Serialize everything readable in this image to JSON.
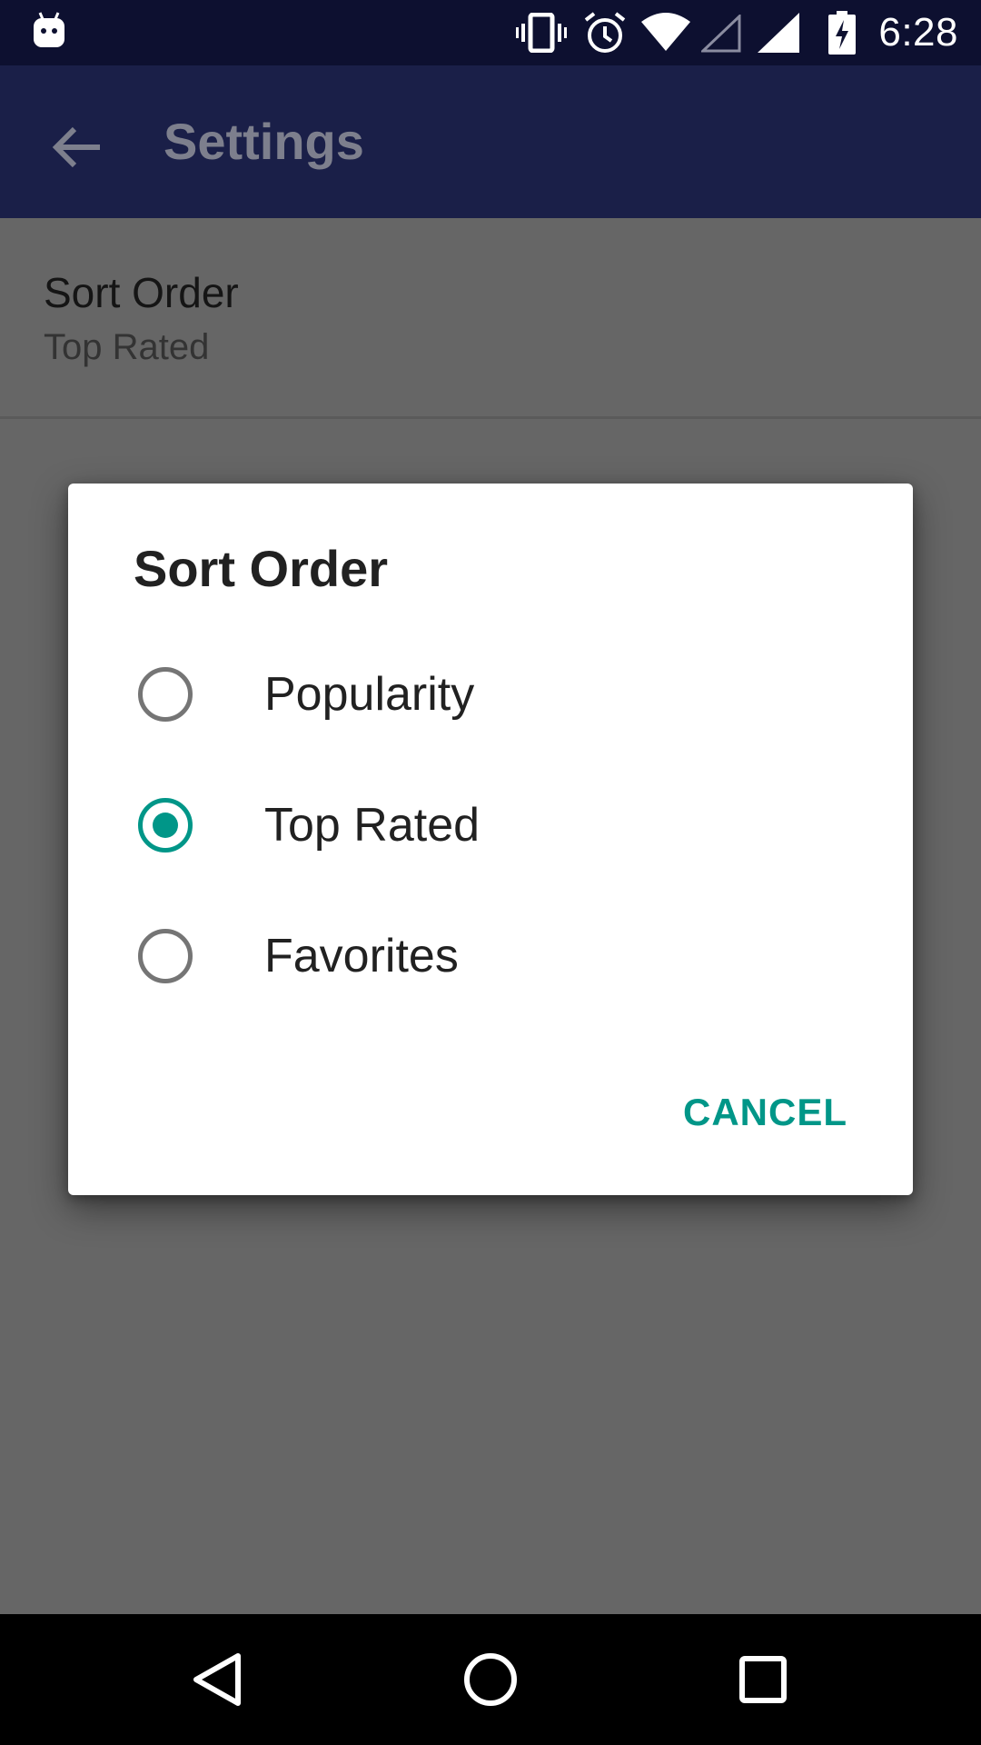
{
  "status_bar": {
    "time": "6:28",
    "icons": [
      "android-debug-icon",
      "vibrate-icon",
      "alarm-icon",
      "wifi-icon",
      "signal-empty-icon",
      "signal-full-icon",
      "battery-charging-icon"
    ]
  },
  "app_bar": {
    "title": "Settings",
    "back_icon": "arrow-back-icon"
  },
  "preference": {
    "title": "Sort Order",
    "summary": "Top Rated"
  },
  "dialog": {
    "title": "Sort Order",
    "options": [
      {
        "label": "Popularity",
        "checked": false
      },
      {
        "label": "Top Rated",
        "checked": true
      },
      {
        "label": "Favorites",
        "checked": false
      }
    ],
    "cancel_label": "CANCEL"
  },
  "nav_bar": {
    "icons": [
      "back-triangle-icon",
      "home-circle-icon",
      "recents-square-icon"
    ]
  },
  "colors": {
    "accent": "#009688",
    "status_bar": "#0d1030",
    "app_bar": "#1a1f48",
    "scrim_background": "#666666"
  }
}
